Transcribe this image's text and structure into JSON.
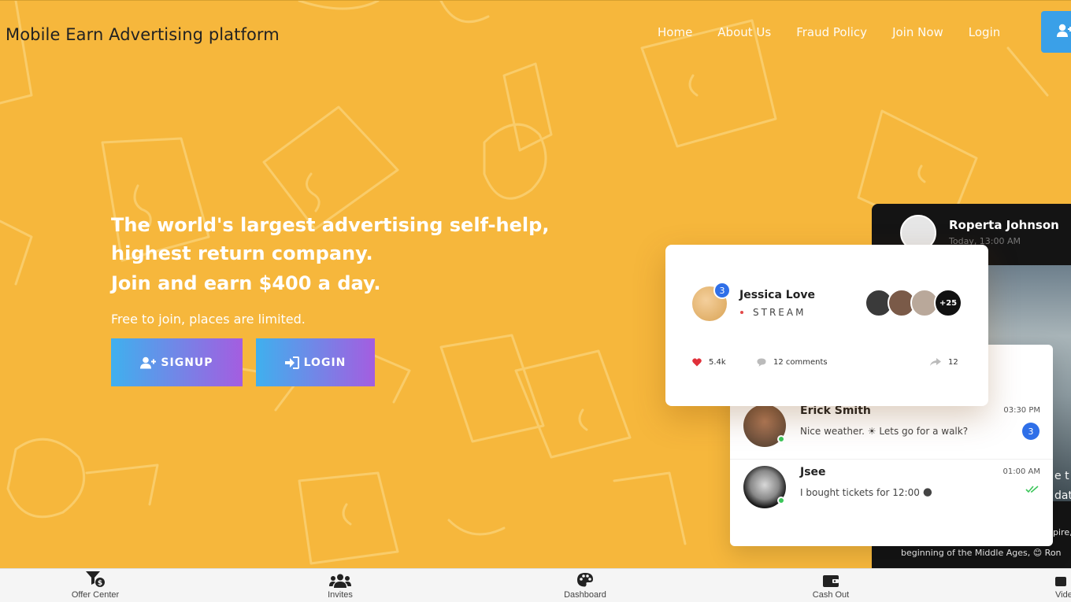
{
  "header": {
    "brand": "Mobile Earn Advertising platform",
    "nav": [
      "Home",
      "About Us",
      "Fraud Policy",
      "Join Now",
      "Login"
    ],
    "user_icon": "user-plus-icon"
  },
  "hero": {
    "headline_line1": "The world's largest advertising self-help,",
    "headline_line2": "highest return company.",
    "subline": "Join and earn $400 a day.",
    "note": "Free to join, places are limited.",
    "signup_label": "SIGNUP",
    "login_label": "LOGIN"
  },
  "dark_card": {
    "name": "Roperta Johnson",
    "time": "Today, 13:00 AM",
    "text1": "e t",
    "text2": "date",
    "text3": "pire,",
    "text4": "beginning of the Middle Ages, 😊 Ron"
  },
  "stream_card": {
    "name": "Jessica Love",
    "badge": "3",
    "label": "STREAM",
    "more_viewers": "+25",
    "likes": "5.4k",
    "comments": "12 comments",
    "shares": "12"
  },
  "chat_card": {
    "rows": [
      {
        "name": "Erick Smith",
        "message": "Nice weather. ☀ Lets go for a walk?",
        "time": "03:30 PM",
        "badge": "3"
      },
      {
        "name": "Jsee",
        "message": "I bought tickets for 12:00 🌑",
        "time": "01:00 AM"
      }
    ]
  },
  "bottom_nav": {
    "items": [
      {
        "label": "Offer Center",
        "icon": "filter-dollar-icon"
      },
      {
        "label": "Invites",
        "icon": "users-icon"
      },
      {
        "label": "Dashboard",
        "icon": "palette-icon"
      },
      {
        "label": "Cash Out",
        "icon": "wallet-icon"
      },
      {
        "label": "Vide",
        "icon": "video-icon"
      }
    ]
  },
  "colors": {
    "background": "#f6b73c",
    "button_gradient_start": "#3fb0ee",
    "button_gradient_end": "#a45de0",
    "accent_blue": "#2f6fe8"
  }
}
